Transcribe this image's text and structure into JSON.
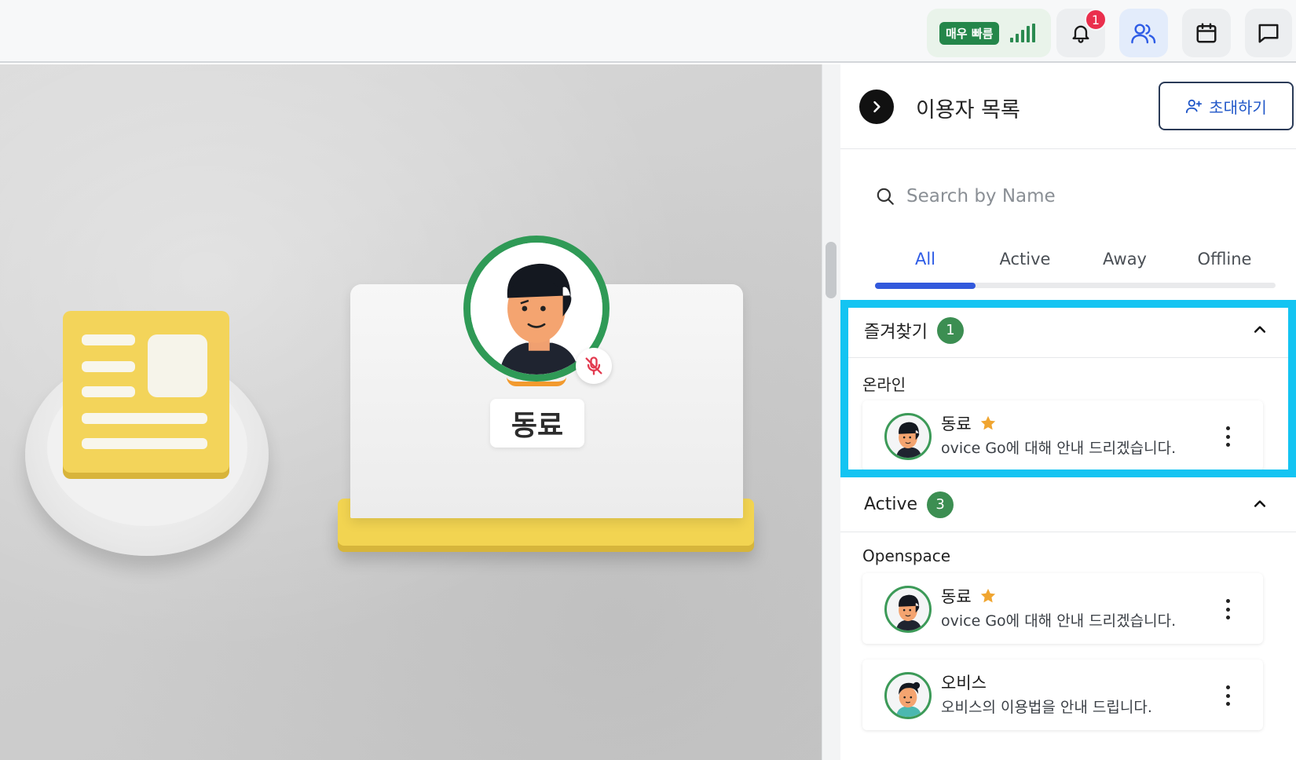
{
  "topbar": {
    "network_badge": "매우 빠름",
    "network_level": 1.0,
    "notification_count": "1"
  },
  "scene": {
    "nameplate": "동료"
  },
  "panel": {
    "title": "이용자 목록",
    "invite_label": "초대하기",
    "search_placeholder": "Search by Name",
    "tabs": [
      "All",
      "Active",
      "Away",
      "Offline"
    ],
    "selected_tab": "All"
  },
  "favorites": {
    "title": "즐겨찾기",
    "count": "1",
    "group": "온라인",
    "users": [
      {
        "name": "동료",
        "message": "ovice Go에 대해 안내 드리겠습니다.",
        "starred": true
      }
    ]
  },
  "active": {
    "title": "Active",
    "count": "3",
    "group": "Openspace",
    "users": [
      {
        "name": "동료",
        "message": "ovice Go에 대해 안내 드리겠습니다.",
        "starred": true
      },
      {
        "name": "오비스",
        "message": "오비스의 이용법을 안내 드립니다.",
        "starred": false
      }
    ]
  },
  "colors": {
    "accent_blue": "#3259dc",
    "highlight": "#14c4f2",
    "online_green": "#3c8e52",
    "notification_red": "#ea2f4d",
    "star": "#f0a530"
  }
}
